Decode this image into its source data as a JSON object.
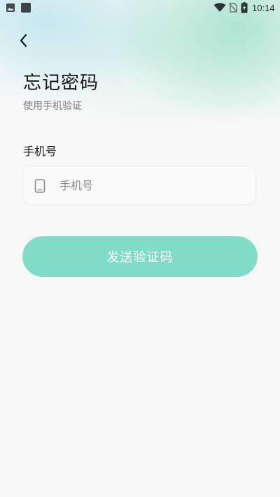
{
  "status_bar": {
    "time": "10:14",
    "icons": [
      "image-icon",
      "app-square-icon",
      "wifi-icon",
      "no-sim-icon",
      "battery-charging-icon"
    ]
  },
  "header": {
    "back_icon": "chevron-left-icon"
  },
  "page": {
    "title": "忘记密码",
    "subtitle": "使用手机验证"
  },
  "form": {
    "phone_label": "手机号",
    "phone_placeholder": "手机号",
    "phone_value": "",
    "phone_icon": "mobile-phone-icon",
    "submit_label": "发送验证码"
  },
  "colors": {
    "accent": "#80dcc6",
    "background": "#f8f8f8",
    "title_text": "#141414",
    "muted_text": "#7b7b7b"
  }
}
